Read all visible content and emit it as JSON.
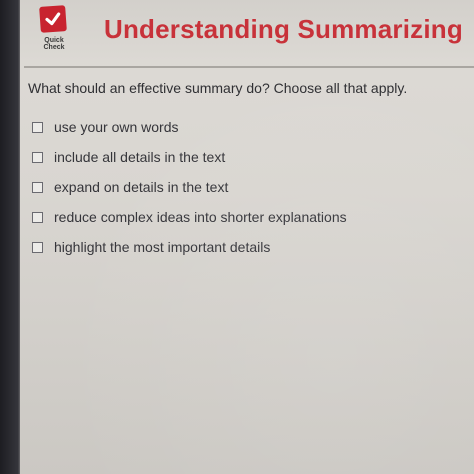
{
  "header": {
    "logo_label": "Quick Check",
    "title": "Understanding Summarizing"
  },
  "question": {
    "prompt": "What should an effective summary do? Choose all that apply."
  },
  "options": [
    {
      "label": "use your own words",
      "checked": false
    },
    {
      "label": "include all details in the text",
      "checked": false
    },
    {
      "label": "expand on details in the text",
      "checked": false
    },
    {
      "label": "reduce complex ideas into shorter explanations",
      "checked": false
    },
    {
      "label": "highlight the most important details",
      "checked": false
    }
  ],
  "colors": {
    "brand_red": "#c8232f",
    "title_red": "#c8323a"
  }
}
